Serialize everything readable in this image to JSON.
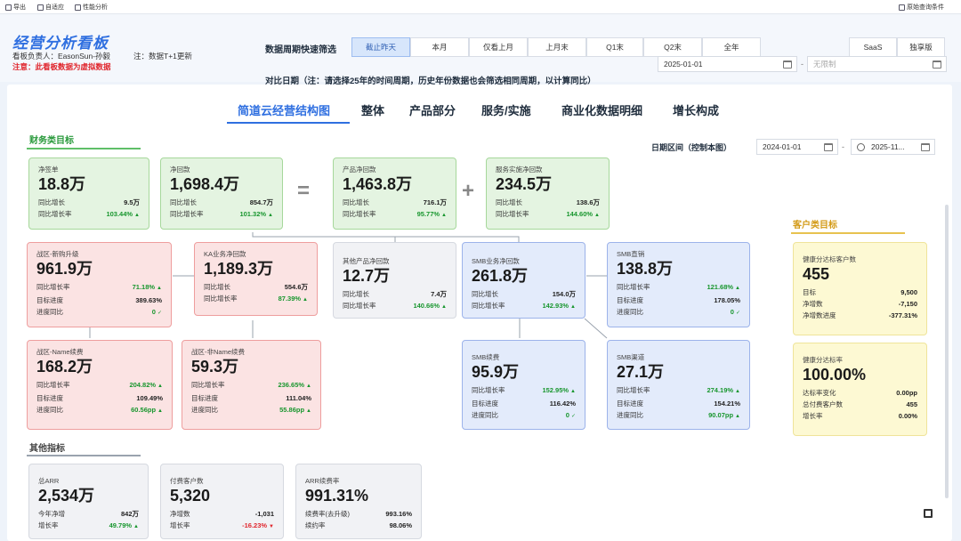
{
  "toolbar": {
    "export": "导出",
    "fit": "自适应",
    "perf": "性能分析",
    "query": "原始查询条件"
  },
  "header": {
    "title": "经营分析看板",
    "owner": "看板负责人：EasonSun-孙毅",
    "update_note": "注：数据T+1更新",
    "warning": "注意：此看板数据为虚拟数据",
    "period_label": "数据周期快速筛选",
    "periods": [
      "截止昨天",
      "本月",
      "仅看上月",
      "上月末",
      "Q1末",
      "Q2末",
      "全年"
    ],
    "editions": [
      "SaaS",
      "独享版"
    ],
    "compare_label": "对比日期（注：请选择25年的时间周期，历史年份数据也会筛选相同周期，以计算同比）",
    "compare_start": "2025-01-01",
    "compare_end_placeholder": "无限制"
  },
  "tabs": [
    "简道云经营结构图",
    "整体",
    "产品部分",
    "服务/实施",
    "商业化数据明细",
    "增长构成"
  ],
  "date_range": {
    "label": "日期区间（控制本图）",
    "start": "2024-01-01",
    "end": "2025-11..."
  },
  "sections": {
    "finance": "财务类目标",
    "customer": "客户类目标",
    "other": "其他指标"
  },
  "operators": {
    "equals": "=",
    "plus": "+"
  },
  "cards": {
    "net_sign": {
      "title": "净签单",
      "value": "18.8万",
      "rows": [
        {
          "label": "同比增长",
          "value": "9.5万"
        },
        {
          "label": "同比增长率",
          "value": "103.44%",
          "dir": "up"
        }
      ]
    },
    "net_collect": {
      "title": "净回款",
      "value": "1,698.4万",
      "rows": [
        {
          "label": "同比增长",
          "value": "854.7万"
        },
        {
          "label": "同比增长率",
          "value": "101.32%",
          "dir": "up"
        }
      ]
    },
    "product_collect": {
      "title": "产品净回款",
      "value": "1,463.8万",
      "rows": [
        {
          "label": "同比增长",
          "value": "716.1万"
        },
        {
          "label": "同比增长率",
          "value": "95.77%",
          "dir": "up"
        }
      ]
    },
    "service_collect": {
      "title": "服务实施净回款",
      "value": "234.5万",
      "rows": [
        {
          "label": "同比增长",
          "value": "138.6万"
        },
        {
          "label": "同比增长率",
          "value": "144.60%",
          "dir": "up"
        }
      ]
    },
    "zone_new": {
      "title": "战区-新购升级",
      "value": "961.9万",
      "rows": [
        {
          "label": "同比增长率",
          "value": "71.18%",
          "dir": "up"
        },
        {
          "label": "目标进度",
          "value": "389.63%"
        },
        {
          "label": "进度同比",
          "value": "0",
          "dir": "check"
        }
      ]
    },
    "ka_collect": {
      "title": "KA业务净回款",
      "value": "1,189.3万",
      "rows": [
        {
          "label": "同比增长",
          "value": "554.6万"
        },
        {
          "label": "同比增长率",
          "value": "87.39%",
          "dir": "up"
        }
      ]
    },
    "other_product": {
      "title": "其他产品净回款",
      "value": "12.7万",
      "rows": [
        {
          "label": "同比增长",
          "value": "7.4万"
        },
        {
          "label": "同比增长率",
          "value": "140.66%",
          "dir": "up"
        }
      ]
    },
    "smb_collect": {
      "title": "SMB业务净回款",
      "value": "261.8万",
      "rows": [
        {
          "label": "同比增长",
          "value": "154.0万"
        },
        {
          "label": "同比增长率",
          "value": "142.93%",
          "dir": "up"
        }
      ]
    },
    "smb_direct": {
      "title": "SMB直销",
      "value": "138.8万",
      "rows": [
        {
          "label": "同比增长率",
          "value": "121.68%",
          "dir": "up"
        },
        {
          "label": "目标进度",
          "value": "178.05%"
        },
        {
          "label": "进度同比",
          "value": "0",
          "dir": "check"
        }
      ]
    },
    "zone_name_renew": {
      "title": "战区-Name续费",
      "value": "168.2万",
      "rows": [
        {
          "label": "同比增长率",
          "value": "204.82%",
          "dir": "up"
        },
        {
          "label": "目标进度",
          "value": "109.49%"
        },
        {
          "label": "进度同比",
          "value": "60.56pp",
          "dir": "up"
        }
      ]
    },
    "zone_nonname_renew": {
      "title": "战区-非Name续费",
      "value": "59.3万",
      "rows": [
        {
          "label": "同比增长率",
          "value": "236.65%",
          "dir": "up"
        },
        {
          "label": "目标进度",
          "value": "111.04%"
        },
        {
          "label": "进度同比",
          "value": "55.86pp",
          "dir": "up"
        }
      ]
    },
    "smb_renew": {
      "title": "SMB续费",
      "value": "95.9万",
      "rows": [
        {
          "label": "同比增长率",
          "value": "152.95%",
          "dir": "up"
        },
        {
          "label": "目标进度",
          "value": "116.42%"
        },
        {
          "label": "进度同比",
          "value": "0",
          "dir": "check"
        }
      ]
    },
    "smb_channel": {
      "title": "SMB渠道",
      "value": "27.1万",
      "rows": [
        {
          "label": "同比增长率",
          "value": "274.19%",
          "dir": "up"
        },
        {
          "label": "目标进度",
          "value": "154.21%"
        },
        {
          "label": "进度同比",
          "value": "90.07pp",
          "dir": "up"
        }
      ]
    },
    "health_customers": {
      "title": "健康分达标客户数",
      "value": "455",
      "rows": [
        {
          "label": "目标",
          "value": "9,500"
        },
        {
          "label": "净增数",
          "value": "-7,150"
        },
        {
          "label": "净增数进度",
          "value": "-377.31%"
        }
      ]
    },
    "health_rate": {
      "title": "健康分达标率",
      "value": "100.00%",
      "rows": [
        {
          "label": "达标率变化",
          "value": "0.00pp"
        },
        {
          "label": "总付费客户数",
          "value": "455"
        },
        {
          "label": "增长率",
          "value": "0.00%"
        }
      ]
    },
    "arr": {
      "title": "总ARR",
      "value": "2,534万",
      "rows": [
        {
          "label": "今年净增",
          "value": "842万"
        },
        {
          "label": "增长率",
          "value": "49.79%",
          "dir": "up"
        }
      ]
    },
    "paying_customers": {
      "title": "付费客户数",
      "value": "5,320",
      "rows": [
        {
          "label": "净增数",
          "value": "-1,031"
        },
        {
          "label": "增长率",
          "value": "-16.23%",
          "dir": "down"
        }
      ]
    },
    "arr_renew": {
      "title": "ARR续费率",
      "value": "991.31%",
      "rows": [
        {
          "label": "续费率(去升级)",
          "value": "993.16%"
        },
        {
          "label": "续约率",
          "value": "98.06%"
        }
      ]
    }
  }
}
